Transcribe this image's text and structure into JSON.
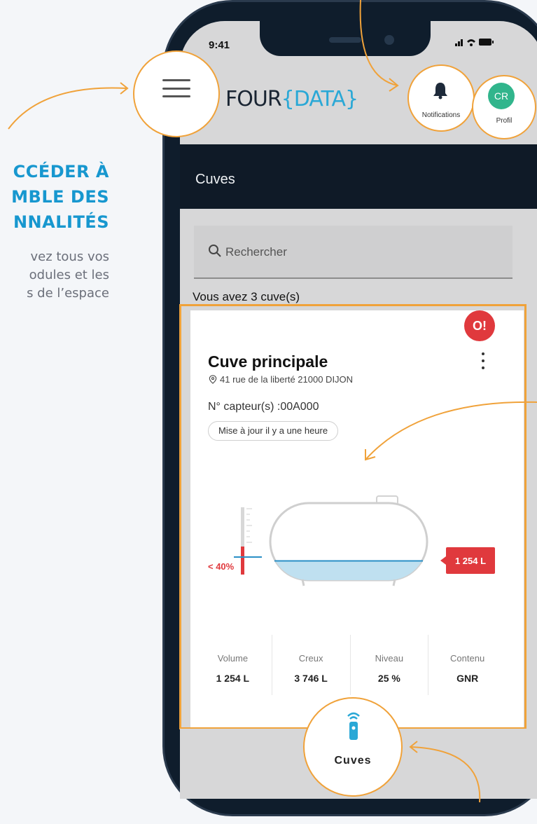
{
  "promo": {
    "title_lines": [
      "CCÉDER À",
      "MBLE DES",
      "NNALITÉS"
    ],
    "desc_lines": [
      "vez tous vos",
      "odules et les",
      "s de l’espace"
    ]
  },
  "status_bar": {
    "time": "9:41",
    "icons": "signal-wifi-battery"
  },
  "header": {
    "logo_left": "FOUR",
    "logo_right": "{DATA}",
    "menu_icon": "hamburger-menu-icon",
    "notifications_label": "Notifications",
    "profile_initials": "CR",
    "profile_label": "Profil"
  },
  "navbar": {
    "title": "Cuves"
  },
  "search": {
    "placeholder": "Rechercher"
  },
  "summary": {
    "count_text": "Vous avez 3 cuve(s)"
  },
  "tank_card": {
    "title": "Cuve principale",
    "address": "41 rue de la liberté 21000 DIJON",
    "sensor": "N° capteur(s) :00A000",
    "updated": "Mise à jour il y a une heure",
    "alert_badge": "O!",
    "fill_level": 0.25,
    "gauge_threshold": "< 40%",
    "volume_tag": "1 254 L",
    "stats": [
      {
        "label": "Volume",
        "value": "1 254 L"
      },
      {
        "label": "Creux",
        "value": "3 746 L"
      },
      {
        "label": "Niveau",
        "value": "25 %"
      },
      {
        "label": "Contenu",
        "value": "GNR"
      }
    ]
  },
  "tabbar": {
    "active_tab": "Cuves",
    "icon": "remote-sensor-icon"
  },
  "colors": {
    "accent": "#1797cf",
    "callout": "#f0a23a",
    "alert": "#e0393d",
    "navbar": "#0f1a27",
    "avatar": "#31b58c",
    "liquid": "#bfe0f0"
  }
}
